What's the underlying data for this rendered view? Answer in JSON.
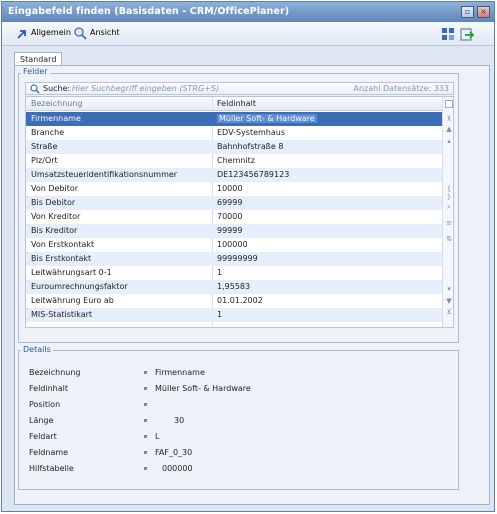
{
  "window": {
    "title": "Eingabefeld finden (Basisdaten - CRM/OfficePlaner)"
  },
  "toolbar": {
    "allgemein": "Allgemein",
    "ansicht": "Ansicht"
  },
  "tabs": [
    "Standard"
  ],
  "felder": {
    "legend": "Felder",
    "search_label": "Suche:",
    "search_placeholder": "Hier Suchbegriff eingeben (STRG+S)",
    "count_text": "Anzahl Datensätze: 333",
    "columns": [
      "Bezeichnung",
      "Feldinhalt"
    ],
    "rows": [
      [
        "Firmenname",
        "Müller Soft- & Hardware"
      ],
      [
        "Branche",
        "EDV-Systemhaus"
      ],
      [
        "Straße",
        "Bahnhofstraße 8"
      ],
      [
        "Plz/Ort",
        "Chemnitz"
      ],
      [
        "Umsatzsteueridentifikationsnummer",
        "DE123456789123"
      ],
      [
        "Von Debitor",
        "10000"
      ],
      [
        "Bis Debitor",
        "69999"
      ],
      [
        "Von Kreditor",
        "70000"
      ],
      [
        "Bis Kreditor",
        "99999"
      ],
      [
        "Von Erstkontakt",
        "100000"
      ],
      [
        "Bis Erstkontakt",
        "99999999"
      ],
      [
        "Leitwährungsart 0-1",
        "1"
      ],
      [
        "Euroumrechnungsfaktor",
        "1,95583"
      ],
      [
        "Leitwährung Euro ab",
        "01.01.2002"
      ],
      [
        "MIS-Statistikart",
        "1"
      ]
    ]
  },
  "details": {
    "legend": "Details",
    "items": [
      {
        "label": "Bezeichnung",
        "value": "Firmenname"
      },
      {
        "label": "Feldinhalt",
        "value": "Müller Soft- & Hardware"
      },
      {
        "label": "Position",
        "value": ""
      },
      {
        "label": "Länge",
        "value": "30"
      },
      {
        "label": "Feldart",
        "value": "L"
      },
      {
        "label": "Feldname",
        "value": "FAF_0_30"
      },
      {
        "label": "Hilfstabelle",
        "value": "000000"
      }
    ]
  },
  "colors": {
    "titlebar": "#5f86bb",
    "selection": "#3c6eb8",
    "alt_row": "#e5eefb"
  },
  "icons": [
    "restore-icon",
    "close-icon",
    "arrow-icon",
    "search-icon",
    "grid-icon",
    "export-icon"
  ]
}
